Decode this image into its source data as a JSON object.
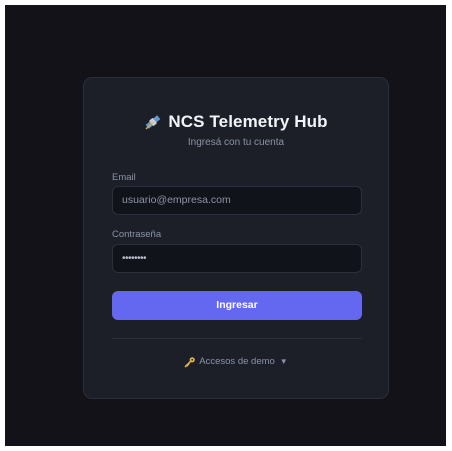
{
  "login": {
    "title": "NCS Telemetry Hub",
    "subtitle": "Ingresá con tu cuenta",
    "email": {
      "label": "Email",
      "placeholder": "usuario@empresa.com"
    },
    "password": {
      "label": "Contraseña",
      "value": "••••••••"
    },
    "submit_label": "Ingresar",
    "demo_access": {
      "label": "Accesos de demo",
      "chevron": "▼",
      "icon": "key-icon"
    },
    "logo_icon": "satellite-icon"
  },
  "colors": {
    "background": "#121218",
    "card": "#1c1f28",
    "accent": "#6468f0",
    "text_muted": "#8a93a6"
  }
}
